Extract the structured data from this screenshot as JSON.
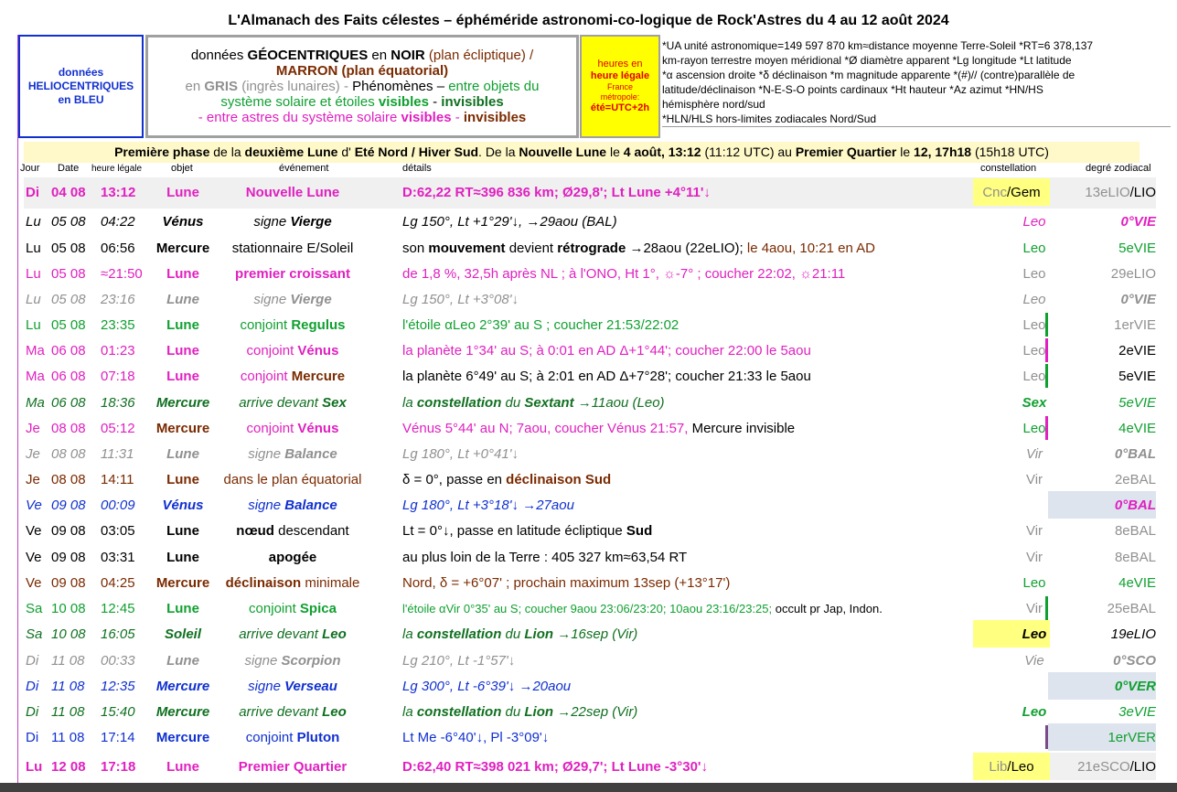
{
  "title": "L'Almanach des Faits célestes – éphéméride astronomi-co-logique de Rock'Astres du 4 au 12 août 2024",
  "legend": {
    "helio": [
      "données",
      "HELIOCENTRIQUES",
      "en BLEU"
    ],
    "geo_line1_pre": "données ",
    "geo_line1_bold": "GÉOCENTRIQUES",
    "geo_line1_mid": " en ",
    "geo_line1_noir": "NOIR",
    "geo_line1_post": " (plan écliptique)  /",
    "geo_line2": "MARRON (plan équatorial)",
    "geo_line3_a": "en ",
    "geo_line3_gris": "GRIS",
    "geo_line3_b": " (ingrès lunaires)  -  ",
    "geo_line3_c": "Phénomènes – ",
    "geo_line3_d": "entre objets du",
    "geo_line4_a": "système solaire et étoiles ",
    "geo_line4_b": "visibles",
    "geo_line4_c": " - ",
    "geo_line4_d": "invisibles",
    "geo_line5_a": "- entre astres du système solaire ",
    "geo_line5_b": "visibles",
    "geo_line5_c": " - ",
    "geo_line5_d": "invisibles",
    "hours_1": "heures en",
    "hours_2": "heure légale",
    "hours_3": "France",
    "hours_4": "métropole:",
    "hours_5": "été=UTC+2h",
    "notes": [
      "*UA unité astronomique=149 597 870 km≈distance moyenne Terre-Soleil   *RT=6 378,137",
      "km-rayon terrestre moyen méridional   *Ø diamètre apparent  *Lg longitude *Lt latitude",
      "*α ascension droite *δ déclinaison  *m magnitude apparente  *(#)// (contre)parallèle de",
      "latitude/déclinaison   *N-E-S-O points cardinaux  *Ht hauteur  *Az azimut   *HN/HS",
      "hémisphère nord/sud",
      "*HLN/HLS hors-limites zodiacales Nord/Sud"
    ]
  },
  "phase": {
    "a": "Première phase",
    "b": " de la ",
    "c": "deuxième Lune",
    "d": " d' ",
    "e": "Eté Nord / Hiver Sud",
    "f": ". De la ",
    "g": "Nouvelle Lune",
    "h": " le ",
    "i": "4 août, 13:12",
    "j": " (11:12 UTC) au ",
    "k": "Premier Quartier",
    "l": " le ",
    "m": "12, 17h18",
    "n": " (15h18 UTC)"
  },
  "headers": {
    "jour": "Jour",
    "date": "Date",
    "heure": "heure légale",
    "objet": "objet",
    "evenement": "événement",
    "details": "détails",
    "constellation": "constellation",
    "degre": "degré zodiacal"
  },
  "colors": {
    "magenta": "#e020c0",
    "black": "#000000",
    "gray": "#909090",
    "green": "#10a030",
    "darkgreen": "#107020",
    "maroon": "#7a2a00",
    "blue": "#1030d0",
    "brown": "#6a3a00"
  },
  "rows": [
    {
      "jour": "Di",
      "date": "04 08",
      "heure": "13:12",
      "objet": "Lune",
      "evt_pre": "",
      "evt_bold": "Nouvelle Lune",
      "evt_post": "",
      "details": "D:62,22 RT≈396 836 km; Ø29,8'; Lt Lune +4°11'↓",
      "con": "Cnc/Gem",
      "deg": "13eLIO/LIO"
    },
    {
      "jour": "Lu",
      "date": "05 08",
      "heure": "04:22",
      "objet": "Vénus",
      "evt_pre": "signe ",
      "evt_bold": "Vierge",
      "evt_post": "",
      "details": "Lg 150°, Lt +1°29'↓, →29aou (BAL)",
      "con": "Leo",
      "deg": "0°VIE"
    },
    {
      "jour": "Lu",
      "date": "05 08",
      "heure": "06:56",
      "objet": "Mercure",
      "evt_pre": "stationnaire E/Soleil",
      "evt_bold": "",
      "evt_post": "",
      "details_a": "son ",
      "details_b": "mouvement",
      "details_c": " devient ",
      "details_d": "rétrograde",
      "details_e": " →28aou (22eLIO); ",
      "details_f": "le 4aou, 10:21 en AD",
      "con": "Leo",
      "deg": "5eVIE"
    },
    {
      "jour": "Lu",
      "date": "05 08",
      "heure": "≈21:50",
      "objet": "Lune",
      "evt_pre": "",
      "evt_bold": "premier croissant",
      "evt_post": "",
      "details": "de 1,8 %, 32,5h après NL ; à l'ONO, Ht 1°, ☼-7° ; coucher 22:02,  ☼21:11",
      "con": "Leo",
      "deg": "29eLIO"
    },
    {
      "jour": "Lu",
      "date": "05 08",
      "heure": "23:16",
      "objet": "Lune",
      "evt_pre": "signe ",
      "evt_bold": "Vierge",
      "evt_post": "",
      "details": "Lg 150°, Lt +3°08'↓",
      "con": "Leo",
      "deg": "0°VIE"
    },
    {
      "jour": "Lu",
      "date": "05 08",
      "heure": "23:35",
      "objet": "Lune",
      "evt_pre": "conjoint ",
      "evt_bold": "Regulus",
      "evt_post": "",
      "details": "l'étoile αLeo 2°39' au S ; coucher 21:53/22:02",
      "con": "Leo",
      "deg": "1erVIE"
    },
    {
      "jour": "Ma",
      "date": "06 08",
      "heure": "01:23",
      "objet": "Lune",
      "evt_pre": "conjoint ",
      "evt_bold": "Vénus",
      "evt_post": "",
      "details_a": "la planète 1°34' au S; à 0:01 en AD Δ+1°44'",
      "details_b": "; coucher 22:00 le 5aou",
      "con": "Leo",
      "deg": "2eVIE"
    },
    {
      "jour": "Ma",
      "date": "06 08",
      "heure": "07:18",
      "objet": "Lune",
      "evt_pre": "conjoint ",
      "evt_bold": "Mercure",
      "evt_post": "",
      "details_a": "la planète 6°49' au S; à 2:01 en AD Δ+7°28'",
      "details_b": "; coucher 21:33 le 5aou",
      "con": "Leo",
      "deg": "5eVIE"
    },
    {
      "jour": "Ma",
      "date": "06 08",
      "heure": "18:36",
      "objet": "Mercure",
      "evt_pre": "arrive devant ",
      "evt_bold": "Sex",
      "evt_post": "",
      "details_a": "la ",
      "details_b": "constellation",
      "details_c": " du ",
      "details_d": "Sextant",
      "details_e": " →11aou (Leo)",
      "con": "Sex",
      "deg": "5eVIE"
    },
    {
      "jour": "Je",
      "date": "08 08",
      "heure": "05:12",
      "objet": "Mercure",
      "evt_pre": "conjoint ",
      "evt_bold": "Vénus",
      "evt_post": "",
      "details_a": "Vénus 5°44' au N; 7aou, coucher Vénus 21:57, ",
      "details_b": "Mercure invisible",
      "con": "Leo",
      "deg": "4eVIE"
    },
    {
      "jour": "Je",
      "date": "08 08",
      "heure": "11:31",
      "objet": "Lune",
      "evt_pre": "signe ",
      "evt_bold": "Balance",
      "evt_post": "",
      "details": "Lg 180°, Lt +0°41'↓",
      "con": "Vir",
      "deg": "0°BAL"
    },
    {
      "jour": "Je",
      "date": "08 08",
      "heure": "14:11",
      "objet": "Lune",
      "evt_pre": "dans le plan équatorial",
      "evt_bold": "",
      "evt_post": "",
      "details_a": "δ = 0°, passe en ",
      "details_b": "déclinaison Sud",
      "con": "Vir",
      "deg": "2eBAL"
    },
    {
      "jour": "Ve",
      "date": "09 08",
      "heure": "00:09",
      "objet": "Vénus",
      "evt_pre": "signe ",
      "evt_bold": "Balance",
      "evt_post": "",
      "details": "Lg 180°, Lt +3°18'↓ →27aou",
      "con": "",
      "deg": "0°BAL"
    },
    {
      "jour": "Ve",
      "date": "09 08",
      "heure": "03:05",
      "objet": "Lune",
      "evt_pre": "",
      "evt_bold": "nœud",
      "evt_post": " descendant",
      "details_a": "Lt = 0°↓, passe en latitude écliptique ",
      "details_b": "Sud",
      "con": "Vir",
      "deg": "8eBAL"
    },
    {
      "jour": "Ve",
      "date": "09 08",
      "heure": "03:31",
      "objet": "Lune",
      "evt_pre": "",
      "evt_bold": "apogée",
      "evt_post": "",
      "details": "au plus loin de la Terre : 405 327 km≈63,54 RT",
      "con": "Vir",
      "deg": "8eBAL"
    },
    {
      "jour": "Ve",
      "date": "09 08",
      "heure": "04:25",
      "objet": "Mercure",
      "evt_pre": "",
      "evt_bold": "déclinaison",
      "evt_post": " minimale",
      "details": "Nord, δ = +6°07' ; prochain maximum 13sep (+13°17')",
      "con": "Leo",
      "deg": "4eVIE"
    },
    {
      "jour": "Sa",
      "date": "10 08",
      "heure": "12:45",
      "objet": "Lune",
      "evt_pre": "conjoint ",
      "evt_bold": "Spica",
      "evt_post": "",
      "details_a": "l'étoile αVir 0°35' au S; coucher 9aou 23:06/23:20; 10aou 23:16/23:25; ",
      "details_b": "occult pr Jap, Indon.",
      "con": "Vir",
      "deg": "25eBAL"
    },
    {
      "jour": "Sa",
      "date": "10 08",
      "heure": "16:05",
      "objet": "Soleil",
      "evt_pre": "arrive devant ",
      "evt_bold": "Leo",
      "evt_post": "",
      "details_a": "la ",
      "details_b": "constellation",
      "details_c": " du ",
      "details_d": "Lion",
      "details_e": " →16sep (Vir)",
      "con": "Leo",
      "deg": "19eLIO"
    },
    {
      "jour": "Di",
      "date": "11 08",
      "heure": "00:33",
      "objet": "Lune",
      "evt_pre": "signe ",
      "evt_bold": "Scorpion",
      "evt_post": "",
      "details": "Lg 210°, Lt -1°57'↓",
      "con": "Vie",
      "deg": "0°SCO"
    },
    {
      "jour": "Di",
      "date": "11 08",
      "heure": "12:35",
      "objet": "Mercure",
      "evt_pre": "signe ",
      "evt_bold": "Verseau",
      "evt_post": "",
      "details": "Lg 300°, Lt -6°39'↓ →20aou",
      "con": "",
      "deg": "0°VER"
    },
    {
      "jour": "Di",
      "date": "11 08",
      "heure": "15:40",
      "objet": "Mercure",
      "evt_pre": "arrive devant ",
      "evt_bold": "Leo",
      "evt_post": "",
      "details_a": "la ",
      "details_b": "constellation",
      "details_c": " du ",
      "details_d": "Lion",
      "details_e": " →22sep (Vir)",
      "con": "Leo",
      "deg": "3eVIE"
    },
    {
      "jour": "Di",
      "date": "11 08",
      "heure": "17:14",
      "objet": "Mercure",
      "evt_pre": "conjoint ",
      "evt_bold": "Pluton",
      "evt_post": "",
      "details": "Lt Me -6°40'↓, Pl -3°09'↓",
      "con": "",
      "deg": "1erVER"
    },
    {
      "jour": "Lu",
      "date": "12 08",
      "heure": "17:18",
      "objet": "Lune",
      "evt_pre": "",
      "evt_bold": "Premier Quartier",
      "evt_post": "",
      "details": "D:62,40 RT≈398 021 km; Ø29,7'; Lt Lune -3°30'↓",
      "con": "Lib/Leo",
      "deg": "21eSCO/LIO"
    }
  ]
}
